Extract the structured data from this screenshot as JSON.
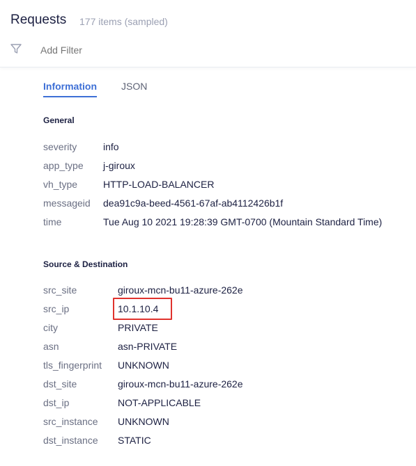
{
  "header": {
    "title": "Requests",
    "count": "177 items (sampled)",
    "filter_placeholder": "Add Filter",
    "filter_icon": "funnel-icon"
  },
  "tabs": [
    {
      "label": "Information",
      "active": true
    },
    {
      "label": "JSON",
      "active": false
    }
  ],
  "general": {
    "title": "General",
    "rows": [
      {
        "key": "severity",
        "value": "info"
      },
      {
        "key": "app_type",
        "value": "j-giroux"
      },
      {
        "key": "vh_type",
        "value": "HTTP-LOAD-BALANCER"
      },
      {
        "key": "messageid",
        "value": "dea91c9a-beed-4561-67af-ab4112426b1f"
      },
      {
        "key": "time",
        "value": "Tue Aug 10 2021 19:28:39 GMT-0700 (Mountain Standard Time)"
      }
    ]
  },
  "source_destination": {
    "title": "Source & Destination",
    "highlighted_key": "src_ip",
    "rows": [
      {
        "key": "src_site",
        "value": "giroux-mcn-bu11-azure-262e"
      },
      {
        "key": "src_ip",
        "value": "10.1.10.4"
      },
      {
        "key": "city",
        "value": "PRIVATE"
      },
      {
        "key": "asn",
        "value": "asn-PRIVATE"
      },
      {
        "key": "tls_fingerprint",
        "value": "UNKNOWN"
      },
      {
        "key": "dst_site",
        "value": "giroux-mcn-bu11-azure-262e"
      },
      {
        "key": "dst_ip",
        "value": "NOT-APPLICABLE"
      },
      {
        "key": "src_instance",
        "value": "UNKNOWN"
      },
      {
        "key": "dst_instance",
        "value": "STATIC"
      }
    ]
  },
  "colors": {
    "accent": "#3d6fd6",
    "text": "#1c2042",
    "muted": "#6a6f83",
    "highlight_border": "#e0322d"
  }
}
